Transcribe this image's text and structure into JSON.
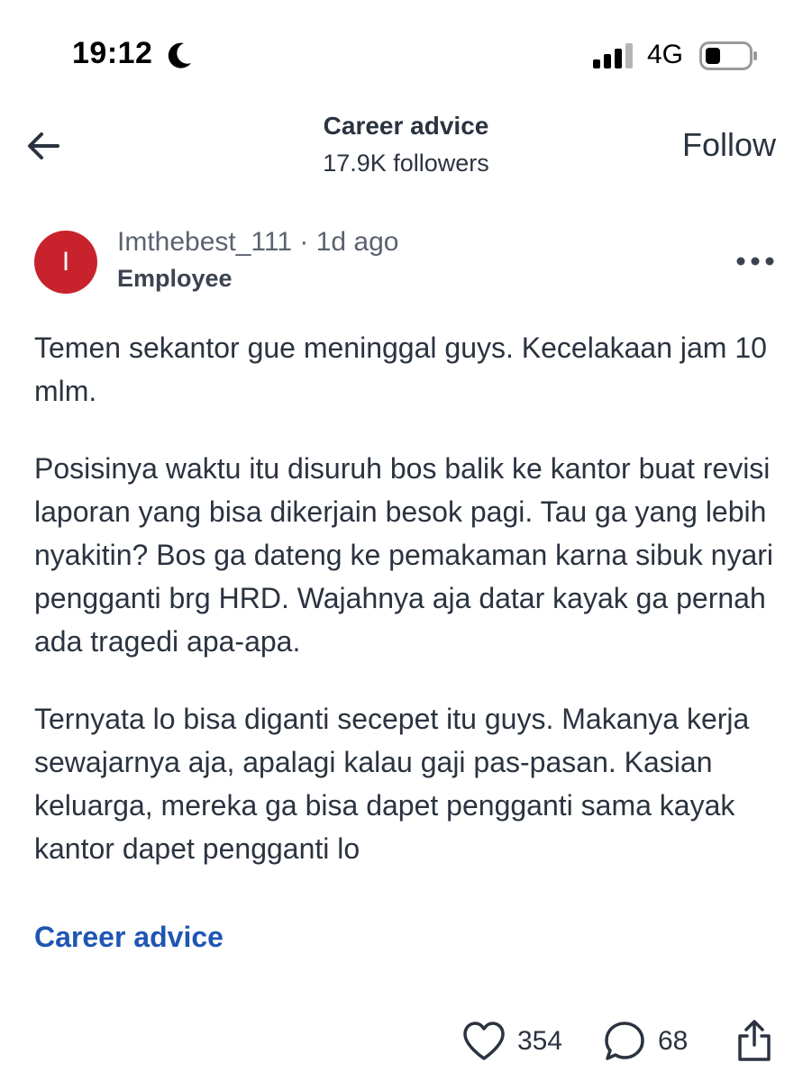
{
  "status_bar": {
    "time": "19:12",
    "network": "4G",
    "icons": [
      "moon-icon",
      "signal-icon",
      "battery-icon"
    ]
  },
  "header": {
    "title": "Career advice",
    "followers": "17.9K followers",
    "follow_label": "Follow",
    "back_icon": "arrow-left-icon"
  },
  "post": {
    "avatar_initial": "I",
    "author": "Imthebest_111",
    "separator": " · ",
    "time_ago": "1d ago",
    "role": "Employee",
    "paragraphs": [
      "Temen sekantor gue meninggal guys. Kecelakaan jam 10 mlm.",
      "Posisinya waktu itu disuruh bos balik ke kantor buat revisi laporan yang bisa dikerjain besok pagi. Tau ga yang lebih nyakitin? Bos ga dateng ke pemakaman karna sibuk nyari pengganti brg HRD. Wajahnya aja datar kayak ga pernah ada tragedi apa-apa.",
      "Ternyata lo bisa diganti secepet itu guys. Makanya kerja sewajarnya aja, apalagi kalau gaji pas-pasan. Kasian keluarga, mereka ga bisa dapet pengganti sama kayak kantor dapet pengganti lo"
    ],
    "topic": "Career advice"
  },
  "actions": {
    "likes": "354",
    "comments": "68"
  },
  "colors": {
    "avatar": "#c8232c",
    "link": "#1f56b3",
    "text": "#2b3340"
  }
}
